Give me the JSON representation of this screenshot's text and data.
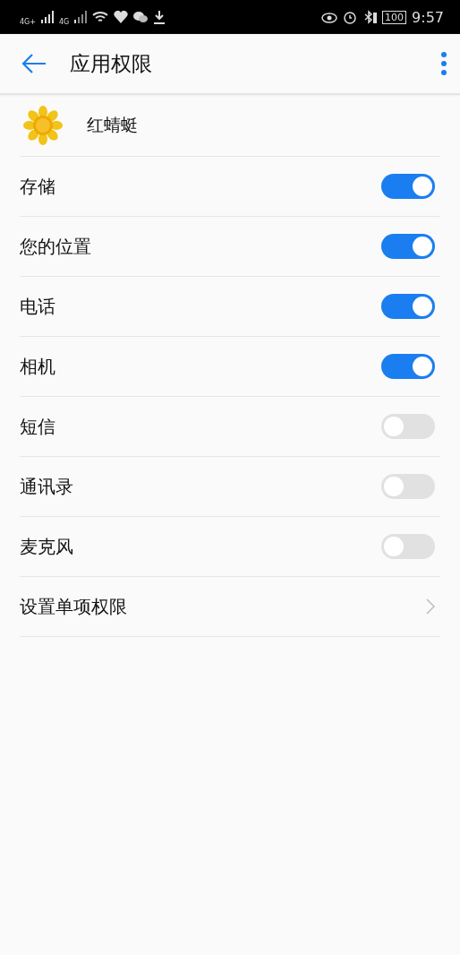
{
  "status_bar": {
    "sim1": "4G+",
    "sim2": "4G",
    "battery": "100",
    "time": "9:57"
  },
  "app_bar": {
    "title": "应用权限"
  },
  "app": {
    "name": "红蜻蜓"
  },
  "permissions": [
    {
      "label": "存储",
      "on": true
    },
    {
      "label": "您的位置",
      "on": true
    },
    {
      "label": "电话",
      "on": true
    },
    {
      "label": "相机",
      "on": true
    },
    {
      "label": "短信",
      "on": false
    },
    {
      "label": "通讯录",
      "on": false
    },
    {
      "label": "麦克风",
      "on": false
    }
  ],
  "more_item": {
    "label": "设置单项权限"
  }
}
